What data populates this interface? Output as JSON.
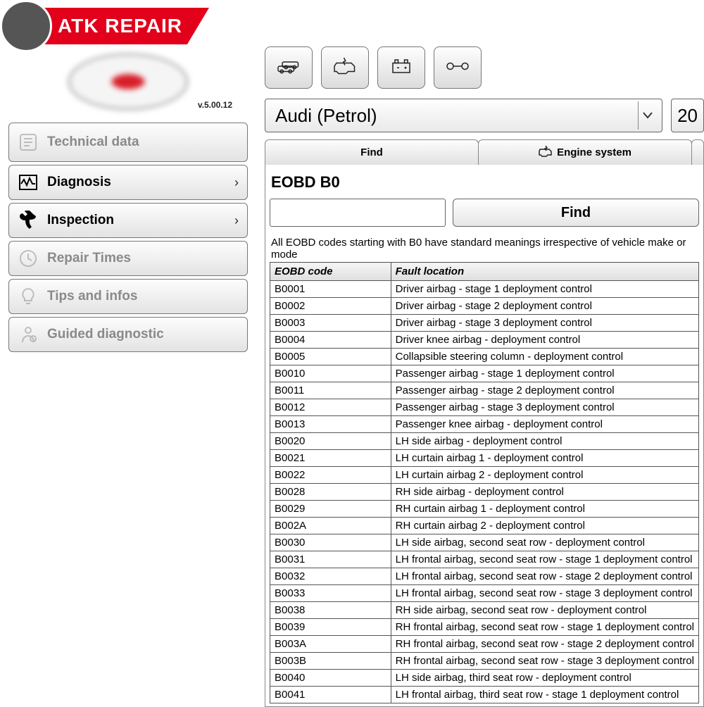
{
  "branding": {
    "badge": "ATK REPAIR",
    "version": "v.5.00.12"
  },
  "sidebar": {
    "items": [
      {
        "key": "techdata",
        "label": "Technical data",
        "dim": true,
        "chevron": false
      },
      {
        "key": "diagnosis",
        "label": "Diagnosis",
        "dim": false,
        "chevron": true
      },
      {
        "key": "inspection",
        "label": "Inspection",
        "dim": false,
        "chevron": true
      },
      {
        "key": "repair",
        "label": "Repair Times",
        "dim": true,
        "chevron": false
      },
      {
        "key": "tips",
        "label": "Tips and infos",
        "dim": true,
        "chevron": false
      },
      {
        "key": "guided",
        "label": "Guided diagnostic",
        "dim": true,
        "chevron": false
      }
    ]
  },
  "selector": {
    "vehicle": "Audi (Petrol)",
    "year": "20"
  },
  "tabs": {
    "find": "Find",
    "engine": "Engine system"
  },
  "section": {
    "title": "EOBD B0",
    "find_label": "Find",
    "note": "All EOBD codes starting with B0 have standard meanings irrespective of vehicle make or mode"
  },
  "table": {
    "headers": {
      "code": "EOBD code",
      "fault": "Fault location"
    },
    "rows": [
      {
        "code": "B0001",
        "fault": "Driver airbag - stage 1 deployment control"
      },
      {
        "code": "B0002",
        "fault": "Driver airbag - stage 2 deployment control"
      },
      {
        "code": "B0003",
        "fault": "Driver airbag - stage 3 deployment control"
      },
      {
        "code": "B0004",
        "fault": "Driver knee airbag - deployment control"
      },
      {
        "code": "B0005",
        "fault": "Collapsible steering column - deployment control"
      },
      {
        "code": "B0010",
        "fault": "Passenger airbag - stage 1 deployment control"
      },
      {
        "code": "B0011",
        "fault": "Passenger airbag - stage 2 deployment control"
      },
      {
        "code": "B0012",
        "fault": "Passenger airbag - stage 3 deployment control"
      },
      {
        "code": "B0013",
        "fault": "Passenger knee airbag - deployment control"
      },
      {
        "code": "B0020",
        "fault": "LH side airbag - deployment control"
      },
      {
        "code": "B0021",
        "fault": "LH curtain airbag 1 - deployment control"
      },
      {
        "code": "B0022",
        "fault": "LH curtain airbag 2 - deployment control"
      },
      {
        "code": "B0028",
        "fault": "RH side airbag - deployment control"
      },
      {
        "code": "B0029",
        "fault": "RH curtain airbag 1 - deployment control"
      },
      {
        "code": "B002A",
        "fault": "RH curtain airbag 2 - deployment control"
      },
      {
        "code": "B0030",
        "fault": "LH side airbag, second seat row - deployment control"
      },
      {
        "code": "B0031",
        "fault": "LH frontal airbag, second seat row - stage 1 deployment control"
      },
      {
        "code": "B0032",
        "fault": "LH frontal airbag, second seat row - stage 2 deployment control"
      },
      {
        "code": "B0033",
        "fault": "LH frontal airbag, second seat row - stage 3 deployment control"
      },
      {
        "code": "B0038",
        "fault": "RH side airbag, second seat row - deployment control"
      },
      {
        "code": "B0039",
        "fault": "RH frontal airbag, second seat row - stage 1 deployment control"
      },
      {
        "code": "B003A",
        "fault": "RH frontal airbag, second seat row - stage 2 deployment control"
      },
      {
        "code": "B003B",
        "fault": "RH frontal airbag, second seat row - stage 3 deployment control"
      },
      {
        "code": "B0040",
        "fault": "LH side airbag, third seat row - deployment control"
      },
      {
        "code": "B0041",
        "fault": "LH frontal airbag, third seat row - stage 1 deployment control"
      }
    ]
  }
}
